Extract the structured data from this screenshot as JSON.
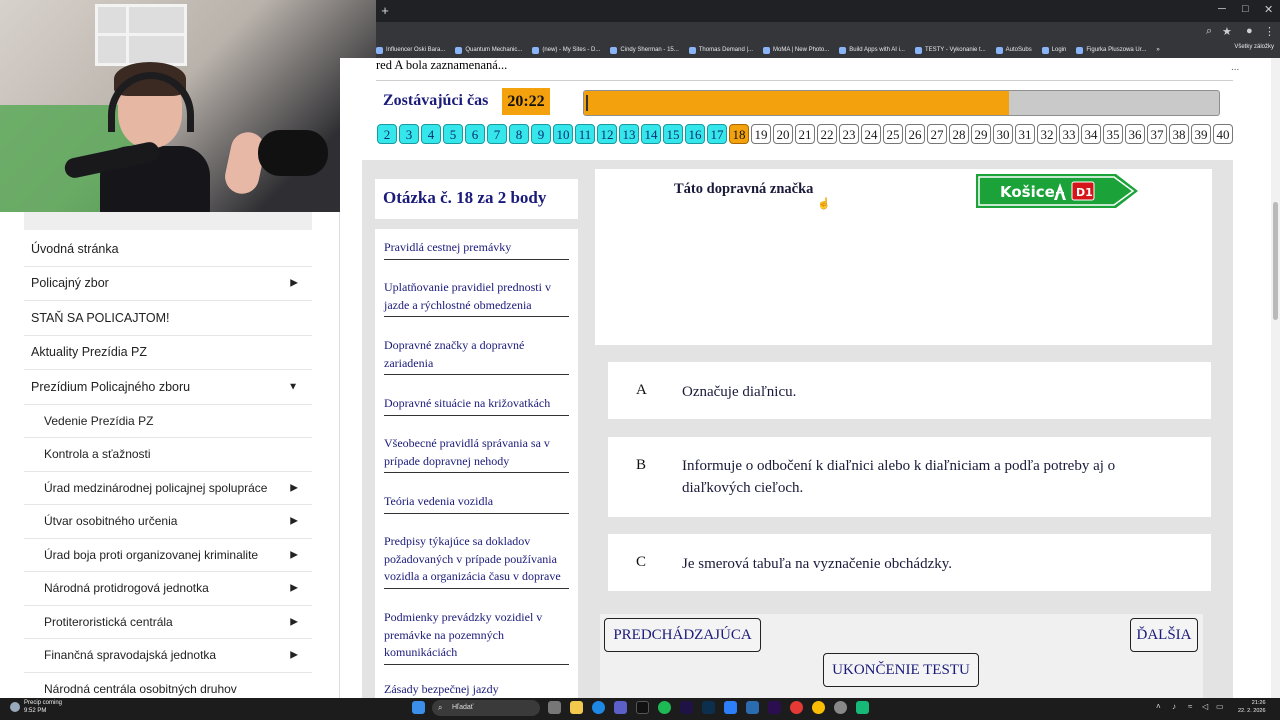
{
  "browser": {
    "new_tab_label": "+",
    "bookmarks": [
      "Influencer Oski Bara...",
      "Quantum Mechanic...",
      "(new) - My Sites - D...",
      "Cindy Sherman - 15...",
      "Thomas Demand |...",
      "MoMA | New Photo...",
      "Build Apps with AI i...",
      "TESTY - Vykonanie t...",
      "AutoSubs",
      "Login",
      "Figurka Pluszowa Ur..."
    ],
    "bookmarks_more": "»",
    "all_bookmarks": "Všetky záložky"
  },
  "sidebar": {
    "items": [
      {
        "label": "Úvodná stránka",
        "arrow": ""
      },
      {
        "label": "Policajný zbor",
        "arrow": "▶"
      },
      {
        "label": "STAŇ SA POLICAJTOM!",
        "arrow": ""
      },
      {
        "label": "Aktuality Prezídia PZ",
        "arrow": ""
      },
      {
        "label": "Prezídium Policajného zboru",
        "arrow": "▼"
      }
    ],
    "subitems": [
      {
        "label": "Vedenie Prezídia PZ",
        "arrow": ""
      },
      {
        "label": "Kontrola a sťažnosti",
        "arrow": ""
      },
      {
        "label": "Úrad medzinárodnej policajnej spolupráce",
        "arrow": "▶"
      },
      {
        "label": "Útvar osobitného určenia",
        "arrow": "▶"
      },
      {
        "label": "Úrad boja proti organizovanej kriminalite",
        "arrow": "▶"
      },
      {
        "label": "Národná protidrogová jednotka",
        "arrow": "▶"
      },
      {
        "label": "Protiteroristická centrála",
        "arrow": "▶"
      },
      {
        "label": "Finančná spravodajská jednotka",
        "arrow": "▶"
      },
      {
        "label": "Národná centrála osobitných druhov",
        "arrow": ""
      }
    ]
  },
  "test": {
    "truncated_text": "red A bola zaznamenaná...",
    "more_dots": "...",
    "timer_label": "Zostávajúci čas",
    "timer_value": "20:22",
    "progress": 0.67,
    "question_numbers": [
      "2",
      "3",
      "4",
      "5",
      "6",
      "7",
      "8",
      "9",
      "10",
      "11",
      "12",
      "13",
      "14",
      "15",
      "16",
      "17",
      "18",
      "19",
      "20",
      "21",
      "22",
      "23",
      "24",
      "25",
      "26",
      "27",
      "28",
      "29",
      "30",
      "31",
      "32",
      "33",
      "34",
      "35",
      "36",
      "37",
      "38",
      "39",
      "40"
    ],
    "done_up_to": "17",
    "current": "18",
    "question_title": "Otázka č. 18 za 2 body",
    "question_text": "Táto dopravná značka",
    "sign": {
      "city": "Košice",
      "route": "D1",
      "color": "#1ba33a"
    },
    "categories": [
      "Pravidlá cestnej premávky",
      "Uplatňovanie pravidiel prednosti v jazde a rýchlostné obmedzenia",
      "Dopravné značky a dopravné zariadenia",
      "Dopravné situácie na križovatkách",
      "Všeobecné pravidlá správania sa v prípade dopravnej nehody",
      "Teória vedenia vozidla",
      "Predpisy týkajúce sa dokladov požadovaných v prípade používania vozidla a organizácia času v doprave",
      "Podmienky prevádzky vozidiel v premávke na pozemných komunikáciách",
      "Zásady bezpečnej jazdy"
    ],
    "answers": [
      {
        "letter": "A",
        "text": "Označuje diaľnicu."
      },
      {
        "letter": "B",
        "text": "Informuje o odbočení k diaľnici alebo k diaľniciam a podľa potreby aj o diaľkových cieľoch."
      },
      {
        "letter": "C",
        "text": "Je smerová tabuľa na vyznačenie obchádzky."
      }
    ],
    "prev_label": "PREDCHÁDZAJÚCA",
    "next_label": "ĎALŠIA",
    "finish_label": "UKONČENIE TESTU",
    "accent": "#f3a20d",
    "done_color": "#35e6ea"
  },
  "taskbar": {
    "weather_title": "Precip coming",
    "weather_time": "9:52 PM",
    "search_placeholder": "Hľadať",
    "time": "21:26",
    "date": "22. 2. 2026"
  }
}
